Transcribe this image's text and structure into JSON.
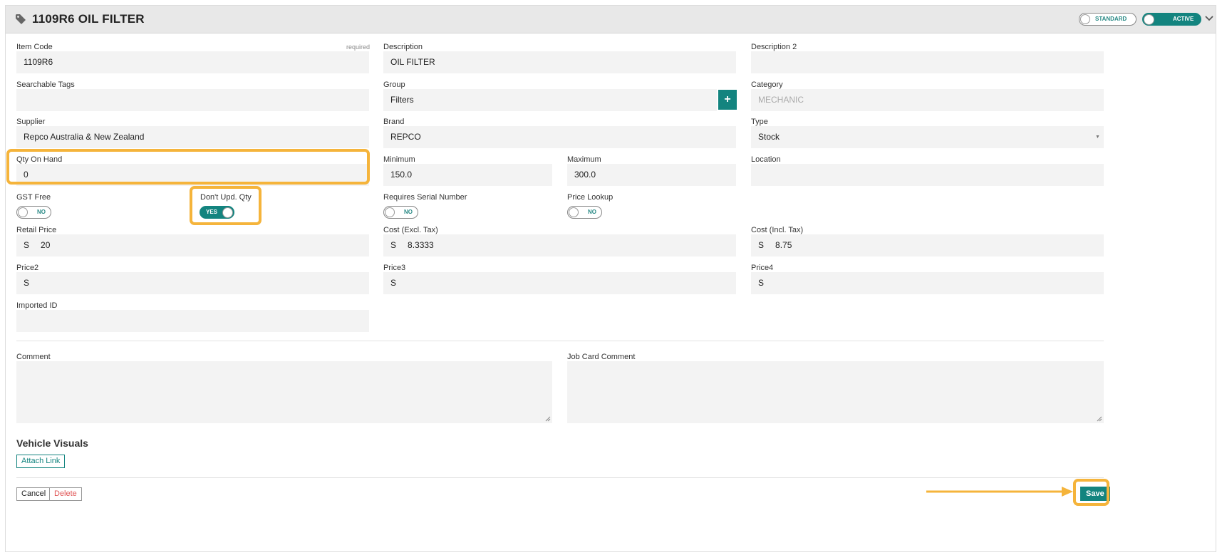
{
  "header": {
    "title": "1109R6 OIL FILTER",
    "standard_label": "STANDARD",
    "active_label": "ACTIVE"
  },
  "fields": {
    "item_code": {
      "label": "Item Code",
      "required": "required",
      "value": "1109R6"
    },
    "description": {
      "label": "Description",
      "value": "OIL FILTER"
    },
    "description2": {
      "label": "Description 2",
      "value": ""
    },
    "searchable_tags": {
      "label": "Searchable Tags",
      "value": ""
    },
    "group": {
      "label": "Group",
      "value": "Filters",
      "add": "+"
    },
    "category": {
      "label": "Category",
      "value": "MECHANIC"
    },
    "supplier": {
      "label": "Supplier",
      "value": "Repco Australia & New Zealand"
    },
    "brand": {
      "label": "Brand",
      "value": "REPCO"
    },
    "type": {
      "label": "Type",
      "value": "Stock",
      "arrow": "▼"
    },
    "qty_on_hand": {
      "label": "Qty On Hand",
      "value": "0"
    },
    "minimum": {
      "label": "Minimum",
      "value": "150.0"
    },
    "maximum": {
      "label": "Maximum",
      "value": "300.0"
    },
    "location": {
      "label": "Location",
      "value": ""
    },
    "gst_free": {
      "label": "GST Free",
      "state": "NO"
    },
    "dont_upd_qty": {
      "label": "Don't Upd. Qty",
      "state": "YES"
    },
    "requires_serial": {
      "label": "Requires Serial Number",
      "state": "NO"
    },
    "price_lookup": {
      "label": "Price Lookup",
      "state": "NO"
    },
    "retail_price": {
      "label": "Retail Price",
      "prefix": "S",
      "value": "20"
    },
    "cost_excl": {
      "label": "Cost (Excl. Tax)",
      "prefix": "S",
      "value": "8.3333"
    },
    "cost_incl": {
      "label": "Cost (Incl. Tax)",
      "prefix": "S",
      "value": "8.75"
    },
    "price2": {
      "label": "Price2",
      "prefix": "S",
      "value": ""
    },
    "price3": {
      "label": "Price3",
      "prefix": "S",
      "value": ""
    },
    "price4": {
      "label": "Price4",
      "prefix": "S",
      "value": ""
    },
    "imported_id": {
      "label": "Imported ID",
      "value": ""
    },
    "comment": {
      "label": "Comment"
    },
    "job_card_comment": {
      "label": "Job Card Comment"
    }
  },
  "vehicle_visuals": {
    "title": "Vehicle Visuals",
    "attach_label": "Attach Link"
  },
  "footer": {
    "cancel_label": "Cancel",
    "delete_label": "Delete",
    "save_label": "Save"
  },
  "colors": {
    "accent": "#13847f",
    "highlight": "#f5b43b",
    "danger": "#e05555"
  }
}
